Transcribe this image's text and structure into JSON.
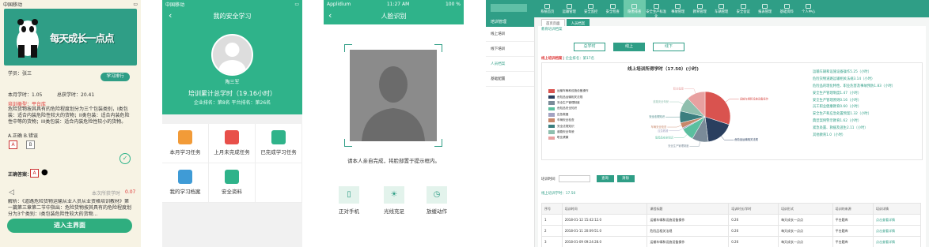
{
  "panel1": {
    "status_carrier": "中国移动",
    "banner_title": "每天成长一点点",
    "student_label": "学员：张三",
    "ranking_button": "学习排行",
    "study_time": "本月学时：1.05",
    "total_time": "总获学时：20.41",
    "category": "培训类型：平台库",
    "question": "危险货物按其具有的危险程度划分为三个包装类别，I类包装：适合内装危险性较大的货物；II类包装：适合内装危险性中等的货物；III类包装：适合内装危险性较小的货物。",
    "options": "A.正确 B.错误",
    "opt_a": "A",
    "opt_b": "B",
    "answer_label": "正确答案：",
    "answer_value": "A",
    "earned": "本次所获学时",
    "earned_value": "0.07",
    "explain": "解析：《道路危险货物运输从业人员从业资格培训教材》第一篇第三章第二节中指出：危险货物按其具有的危险程度划分为3个类别：I类包装危险性较大的货物…",
    "enter_button": "进入主界面"
  },
  "panel2": {
    "status_carrier": "中国移动",
    "title": "我的安全学习",
    "name": "陶三军",
    "total": "培训累计总学时（19.16小时）",
    "rank": "企业排名：第8名    平台排名：第26名",
    "items": [
      {
        "label": "本月学习任务",
        "color": "#f29b38"
      },
      {
        "label": "上月未完成任务",
        "color": "#e8504a"
      },
      {
        "label": "已完成学习任务",
        "color": "#2fb38a"
      },
      {
        "label": "我的学习档案",
        "color": "#3f9bd6"
      },
      {
        "label": "安全资料",
        "color": "#2fb38a"
      }
    ]
  },
  "panel3": {
    "status_carrier": "Applidium",
    "status_time": "11:27 AM",
    "status_battery": "100 %",
    "title": "人脸识别",
    "hint": "请本人亲自完成，将脸部置于提示框内。",
    "tips": [
      {
        "label": "正对手机",
        "icon": "phone-icon",
        "glyph": "▯"
      },
      {
        "label": "光线充足",
        "icon": "bulb-icon",
        "glyph": "☀"
      },
      {
        "label": "放缓动作",
        "icon": "clock-icon",
        "glyph": "◷"
      }
    ]
  },
  "panel4": {
    "nav": [
      "系统首页",
      "运输管理",
      "安全监控",
      "安全检查",
      "隐患排查",
      "安全生产标准化",
      "事故管理",
      "教育管理",
      "车辆管理",
      "安全会议",
      "报表管理",
      "基础资料",
      "个人中心"
    ],
    "nav_active": 4,
    "side_header": "培训管理",
    "side_items": [
      "线上培训",
      "线下培训",
      "人员档案",
      "基础配置"
    ],
    "side_active": 2,
    "top_tabs": [
      "首页页面",
      "人员档案"
    ],
    "crumb": "教育培训档案",
    "main_tabs": [
      "总学时",
      "线上",
      "线下"
    ],
    "main_active": 1,
    "stat_label": "线上培训档案",
    "stat_company": "企业排名：第17名",
    "chart_data": {
      "type": "pie",
      "title": "线上培训所得学时（17.50）(小时)",
      "categories": [
        "运输车辆和设施设备操作",
        "危险品运输相关法规",
        "安全生产管理制度",
        "危险品安全知识",
        "应急救援",
        "车辆安全检查",
        "安全法规知识",
        "道路安全驾驶",
        "职业健康"
      ],
      "values": [
        5.25,
        3.14,
        1.83,
        1.47,
        0.16,
        0.6,
        1.32,
        1.62,
        2.11
      ],
      "colors": [
        "#d9534f",
        "#2a3f5f",
        "#7a8b99",
        "#5bbf9f",
        "#a3a3c2",
        "#c7876a",
        "#3b7f7f",
        "#8fbfae",
        "#e8a0a0"
      ]
    },
    "right_list": [
      "运输车辆和设施设备操作5.25（小时）",
      "危险货物道路运输相关法规3.14（小时）",
      "危险品的理化特性、职业危害及事故预防1.83（小时）",
      "安全生产管理制度1.47（小时）",
      "安全生产管理原则0.16（小时）",
      "员工职业健康教育0.60（小时）",
      "安全生产和应急处置预案1.32（小时）",
      "典型案例警示教育1.62（小时）",
      "紧急处置、救援及逃生2.11（小时）",
      "其他教育1.0（小时）"
    ],
    "filter_label": "培训时间",
    "search_btn": "查询",
    "clear_btn": "清除",
    "section2": "线上培训学时：17.50",
    "table_headers": [
      "序号",
      "培训时间",
      "课程标题",
      "培训时长/学时",
      "培训形式",
      "培训的来源",
      "培训详情"
    ],
    "rows": [
      [
        "1",
        "2018-01-12 15:42:12.0",
        "运输车辆和设施设备操作",
        "0.26",
        "每天成长一点点",
        "平台题库",
        "点击查看详情"
      ],
      [
        "2",
        "2018-01-11 20:09:51.0",
        "危险品相关法规",
        "0.26",
        "每天成长一点点",
        "平台题库",
        "点击查看详情"
      ],
      [
        "3",
        "2018-01-09 09:24:28.0",
        "运输车辆和设施设备操作",
        "0.26",
        "每天成长一点点",
        "平台题库",
        "点击查看详情"
      ]
    ]
  }
}
